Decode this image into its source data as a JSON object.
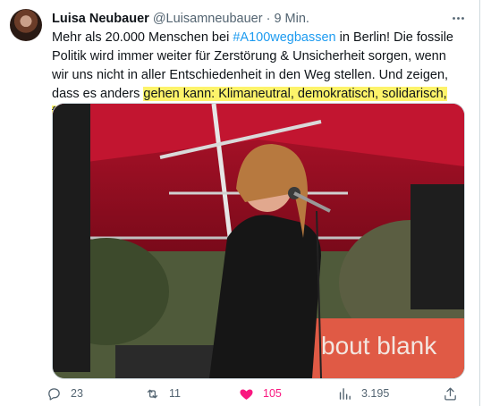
{
  "tweet": {
    "author_name": "Luisa Neubauer",
    "handle": "@Luisamneubauer",
    "separator": "·",
    "time": "9 Min.",
    "text_part1": "Mehr als 20.000 Menschen bei ",
    "hashtag": "#A100wegbassen",
    "text_part2": " in Berlin! Die fossile Politik wird immer weiter für Zerstörung & Unsicherheit sorgen, wenn wir uns nicht in aller Entschiedenheit in den Weg stellen. Und zeigen, dass es anders ",
    "text_highlight": "gehen kann: Klimaneutral, demokratisch, solidarisch, frei.",
    "image_sign": "bout blank"
  },
  "actions": {
    "replies": "23",
    "retweets": "11",
    "likes": "105",
    "views": "3.195"
  },
  "colors": {
    "link": "#1d9bf0",
    "like": "#f91880",
    "muted": "#536471",
    "highlight": "#fdf36a"
  },
  "icons": [
    "avatar",
    "more-icon",
    "reply-icon",
    "retweet-icon",
    "heart-icon",
    "views-icon",
    "share-icon"
  ]
}
